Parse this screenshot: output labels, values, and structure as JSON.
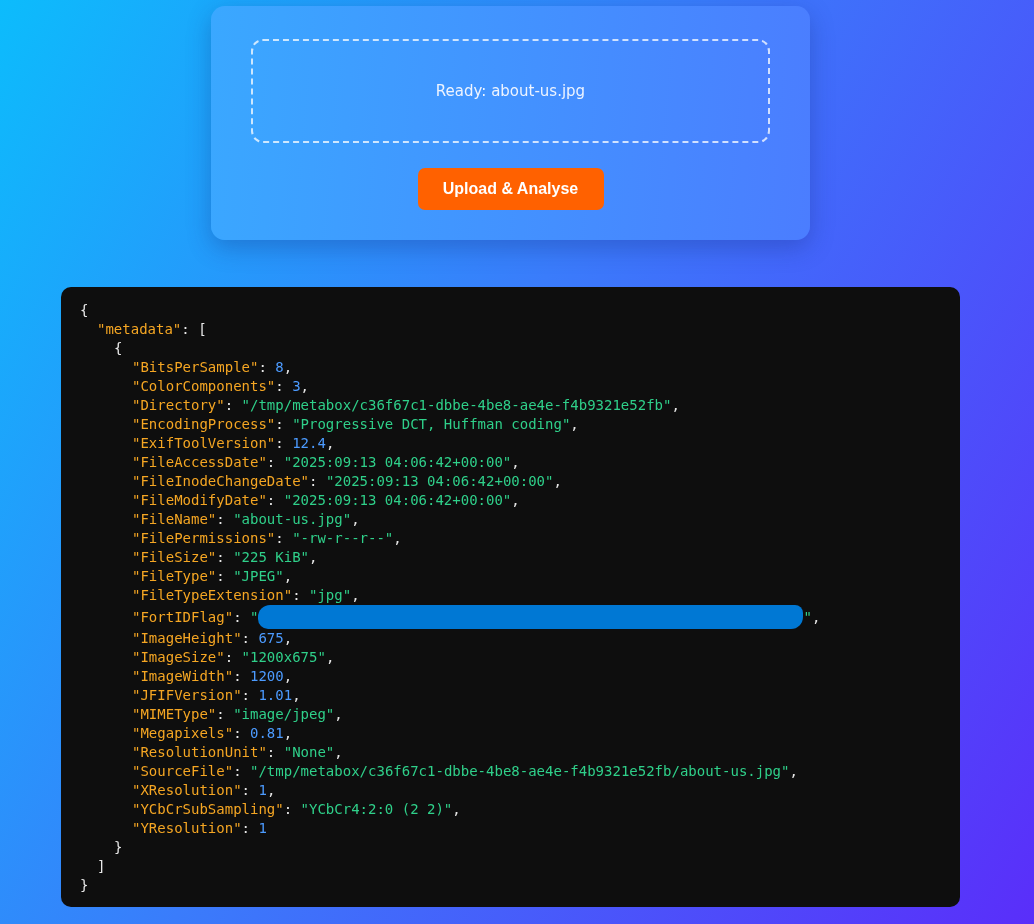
{
  "upload": {
    "status": "Ready: about-us.jpg",
    "button": "Upload & Analyse"
  },
  "output": {
    "open": "{",
    "array_key": "\"metadata\"",
    "array_punct": ":",
    "array_open": "[",
    "item_open": "{",
    "entries": [
      {
        "key": "\"BitsPerSample\"",
        "punct": ":",
        "value": "8",
        "kind": "number",
        "trail": ","
      },
      {
        "key": "\"ColorComponents\"",
        "punct": ":",
        "value": "3",
        "kind": "number",
        "trail": ","
      },
      {
        "key": "\"Directory\"",
        "punct": ":",
        "value": "\"/tmp/metabox/c36f67c1-dbbe-4be8-ae4e-f4b9321e52fb\"",
        "kind": "string",
        "trail": ","
      },
      {
        "key": "\"EncodingProcess\"",
        "punct": ":",
        "value": "\"Progressive DCT, Huffman coding\"",
        "kind": "string",
        "trail": ","
      },
      {
        "key": "\"ExifToolVersion\"",
        "punct": ":",
        "value": "12.4",
        "kind": "number",
        "trail": ","
      },
      {
        "key": "\"FileAccessDate\"",
        "punct": ":",
        "value": "\"2025:09:13 04:06:42+00:00\"",
        "kind": "string",
        "trail": ","
      },
      {
        "key": "\"FileInodeChangeDate\"",
        "punct": ":",
        "value": "\"2025:09:13 04:06:42+00:00\"",
        "kind": "string",
        "trail": ","
      },
      {
        "key": "\"FileModifyDate\"",
        "punct": ":",
        "value": "\"2025:09:13 04:06:42+00:00\"",
        "kind": "string",
        "trail": ","
      },
      {
        "key": "\"FileName\"",
        "punct": ":",
        "value": "\"about-us.jpg\"",
        "kind": "string",
        "trail": ","
      },
      {
        "key": "\"FilePermissions\"",
        "punct": ":",
        "value": "\"-rw-r--r--\"",
        "kind": "string",
        "trail": ","
      },
      {
        "key": "\"FileSize\"",
        "punct": ":",
        "value": "\"225 KiB\"",
        "kind": "string",
        "trail": ","
      },
      {
        "key": "\"FileType\"",
        "punct": ":",
        "value": "\"JPEG\"",
        "kind": "string",
        "trail": ","
      },
      {
        "key": "\"FileTypeExtension\"",
        "punct": ":",
        "value": "\"jpg\"",
        "kind": "string",
        "trail": ","
      },
      {
        "key": "\"FortIDFlag\"",
        "punct": ":",
        "value": "\"",
        "kind": "redacted",
        "after": "\"",
        "trail": ","
      },
      {
        "key": "\"ImageHeight\"",
        "punct": ":",
        "value": "675",
        "kind": "number",
        "trail": ","
      },
      {
        "key": "\"ImageSize\"",
        "punct": ":",
        "value": "\"1200x675\"",
        "kind": "string",
        "trail": ","
      },
      {
        "key": "\"ImageWidth\"",
        "punct": ":",
        "value": "1200",
        "kind": "number",
        "trail": ","
      },
      {
        "key": "\"JFIFVersion\"",
        "punct": ":",
        "value": "1.01",
        "kind": "number",
        "trail": ","
      },
      {
        "key": "\"MIMEType\"",
        "punct": ":",
        "value": "\"image/jpeg\"",
        "kind": "string",
        "trail": ","
      },
      {
        "key": "\"Megapixels\"",
        "punct": ":",
        "value": "0.81",
        "kind": "number",
        "trail": ","
      },
      {
        "key": "\"ResolutionUnit\"",
        "punct": ":",
        "value": "\"None\"",
        "kind": "string",
        "trail": ","
      },
      {
        "key": "\"SourceFile\"",
        "punct": ":",
        "value": "\"/tmp/metabox/c36f67c1-dbbe-4be8-ae4e-f4b9321e52fb/about-us.jpg\"",
        "kind": "string",
        "trail": ","
      },
      {
        "key": "\"XResolution\"",
        "punct": ":",
        "value": "1",
        "kind": "number",
        "trail": ","
      },
      {
        "key": "\"YCbCrSubSampling\"",
        "punct": ":",
        "value": "\"YCbCr4:2:0 (2 2)\"",
        "kind": "string",
        "trail": ","
      },
      {
        "key": "\"YResolution\"",
        "punct": ":",
        "value": "1",
        "kind": "number"
      }
    ],
    "item_close": "}",
    "array_close": "]",
    "close": "}"
  }
}
